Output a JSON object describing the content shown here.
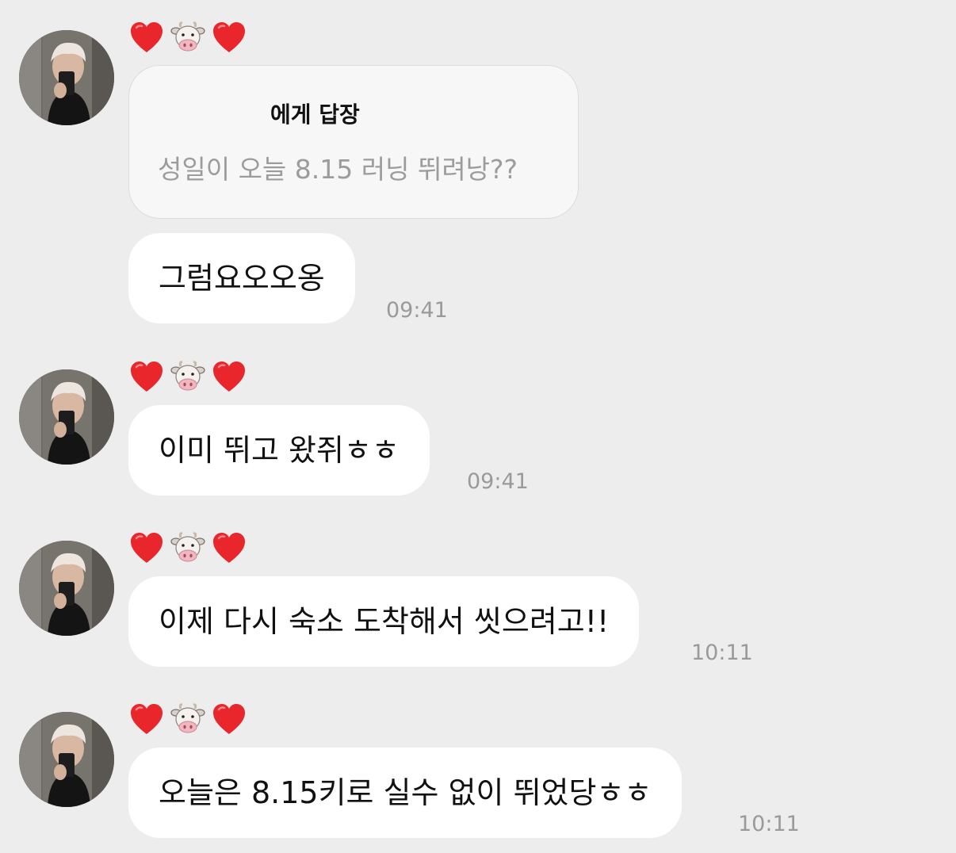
{
  "sender": {
    "display_name_icons": [
      "red-heart-icon",
      "cow-face-icon",
      "red-heart-icon"
    ]
  },
  "messages": [
    {
      "reply": {
        "to_label": "에게 답장",
        "quoted_text": "성일이 오늘 8.15 러닝 뛰려낭??"
      },
      "text": "그럼요오오옹",
      "time": "09:41"
    },
    {
      "text": "이미 뛰고 왔쥐ㅎㅎ",
      "time": "09:41"
    },
    {
      "text": "이제 다시 숙소 도착해서 씻으려고!!",
      "time": "10:11"
    },
    {
      "text": "오늘은 8.15키로 실수 없이 뛰었당ㅎㅎ",
      "time": "10:11"
    }
  ],
  "colors": {
    "background": "#ededed",
    "bubble": "#ffffff",
    "reply_card": "#f7f7f7",
    "heart": "#e8262b",
    "timestamp": "#9a9a9a"
  }
}
